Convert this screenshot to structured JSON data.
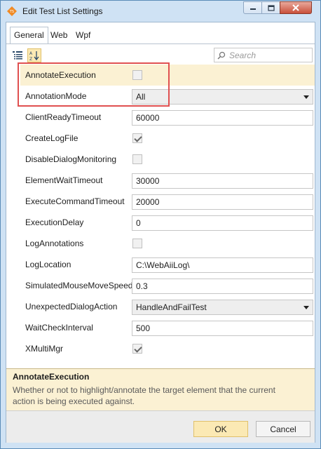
{
  "window": {
    "title": "Edit Test List Settings",
    "app_icon": "telerik-icon",
    "controls": [
      "minimize-icon",
      "maximize-icon",
      "close-icon"
    ]
  },
  "tabs": [
    {
      "label": "General",
      "active": true
    },
    {
      "label": "Web",
      "active": false
    },
    {
      "label": "Wpf",
      "active": false
    }
  ],
  "toolbar": {
    "categorized_icon": "categorized-view-icon",
    "alphabetical_icon": "alphabetical-sort-icon",
    "search_placeholder": "Search"
  },
  "properties": [
    {
      "name": "AnnotateExecution",
      "type": "checkbox",
      "checked": false,
      "selected": true
    },
    {
      "name": "AnnotationMode",
      "type": "select",
      "value": "All"
    },
    {
      "name": "ClientReadyTimeout",
      "type": "text",
      "value": "60000"
    },
    {
      "name": "CreateLogFile",
      "type": "checkbox",
      "checked": true
    },
    {
      "name": "DisableDialogMonitoring",
      "type": "checkbox",
      "checked": false
    },
    {
      "name": "ElementWaitTimeout",
      "type": "text",
      "value": "30000"
    },
    {
      "name": "ExecuteCommandTimeout",
      "type": "text",
      "value": "20000"
    },
    {
      "name": "ExecutionDelay",
      "type": "text",
      "value": "0"
    },
    {
      "name": "LogAnnotations",
      "type": "checkbox",
      "checked": false
    },
    {
      "name": "LogLocation",
      "type": "text",
      "value": "C:\\WebAiiLog\\"
    },
    {
      "name": "SimulatedMouseMoveSpeed",
      "type": "text",
      "value": "0.3"
    },
    {
      "name": "UnexpectedDialogAction",
      "type": "select",
      "value": "HandleAndFailTest"
    },
    {
      "name": "WaitCheckInterval",
      "type": "text",
      "value": "500"
    },
    {
      "name": "XMultiMgr",
      "type": "checkbox",
      "checked": true
    }
  ],
  "description": {
    "title": "AnnotateExecution",
    "text": "Whether or not to highlight/annotate the target element that the current action is being executed against."
  },
  "buttons": {
    "ok": "OK",
    "cancel": "Cancel"
  },
  "colors": {
    "selected_row": "#fbf1d3",
    "highlight_border": "#e05050",
    "titlebar": "#cfe2f4"
  }
}
